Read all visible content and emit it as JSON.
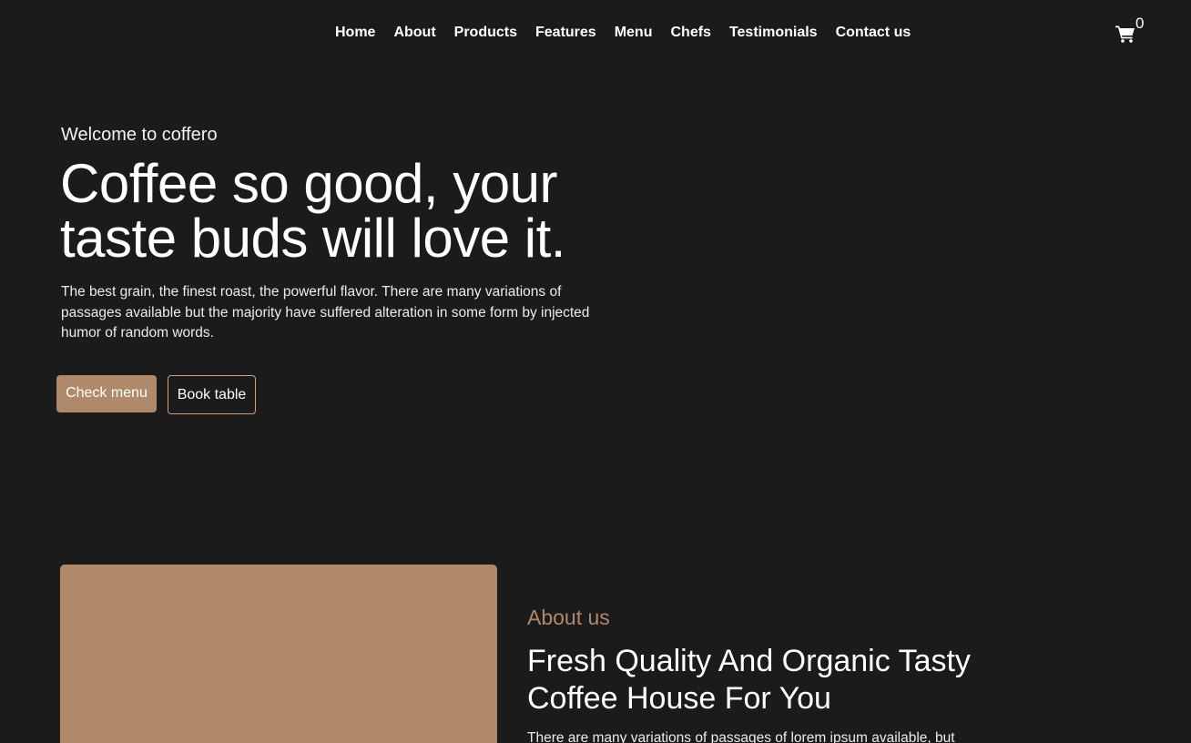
{
  "nav": {
    "items": [
      {
        "label": "Home"
      },
      {
        "label": "About"
      },
      {
        "label": "Products"
      },
      {
        "label": "Features"
      },
      {
        "label": "Menu"
      },
      {
        "label": "Chefs"
      },
      {
        "label": "Testimonials"
      },
      {
        "label": "Contact us"
      }
    ],
    "cart": {
      "icon": "shopping-cart-icon",
      "count": "0"
    }
  },
  "hero": {
    "kicker": "Welcome to coffero",
    "title": "Coffee so good, your taste buds will love it.",
    "description": "The best grain, the finest roast, the powerful flavor. There are many variations of passages available but the majority have suffered alteration in some form by injected humor of random words.",
    "primary_button": "Check menu",
    "secondary_button": "Book table"
  },
  "about": {
    "kicker": "About us",
    "title": "Fresh Quality And Organic Tasty Coffee House For You",
    "description": "There are many variations of passages of lorem ipsum available, but"
  },
  "colors": {
    "background": "#1b1b1b",
    "accent": "#b0896a",
    "text": "#ffffff"
  }
}
